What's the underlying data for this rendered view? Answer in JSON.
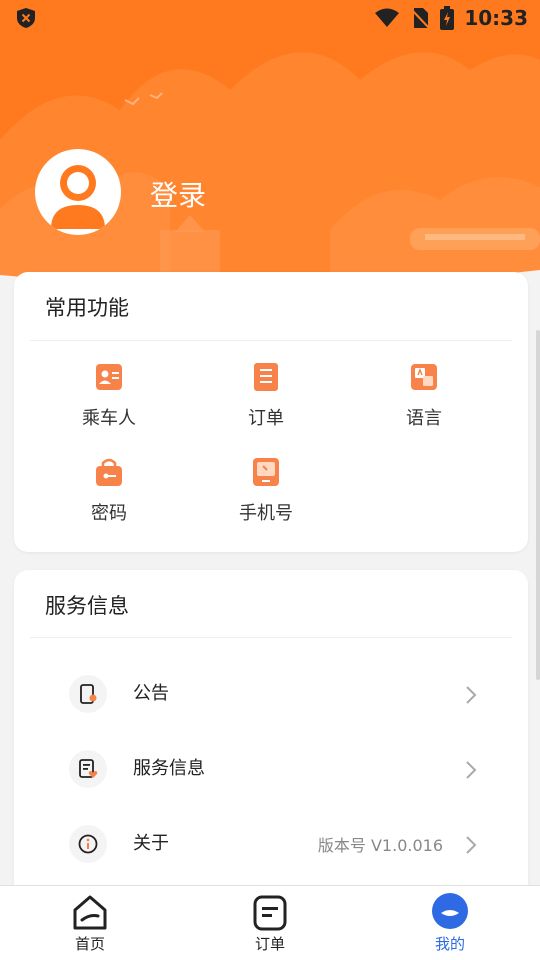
{
  "status_bar": {
    "time": "10:33"
  },
  "profile": {
    "login_label": "登录"
  },
  "common_functions": {
    "title": "常用功能",
    "items": [
      {
        "label": "乘车人",
        "icon": "passenger-icon"
      },
      {
        "label": "订单",
        "icon": "order-icon"
      },
      {
        "label": "语言",
        "icon": "language-icon"
      },
      {
        "label": "密码",
        "icon": "password-icon"
      },
      {
        "label": "手机号",
        "icon": "phone-icon"
      }
    ]
  },
  "service_info": {
    "title": "服务信息",
    "items": [
      {
        "label": "公告",
        "icon": "announcement-icon",
        "value": ""
      },
      {
        "label": "服务信息",
        "icon": "service-info-icon",
        "value": ""
      },
      {
        "label": "关于",
        "icon": "info-icon",
        "value": "版本号 V1.0.016"
      }
    ]
  },
  "tab_bar": {
    "items": [
      {
        "label": "首页",
        "icon": "home-icon"
      },
      {
        "label": "订单",
        "icon": "order-tab-icon"
      },
      {
        "label": "我的",
        "icon": "profile-tab-icon",
        "active": true
      }
    ]
  },
  "colors": {
    "accent": "#ff7a1f",
    "tab_active": "#2d6ae3",
    "icon_orange": "#f7834a"
  }
}
